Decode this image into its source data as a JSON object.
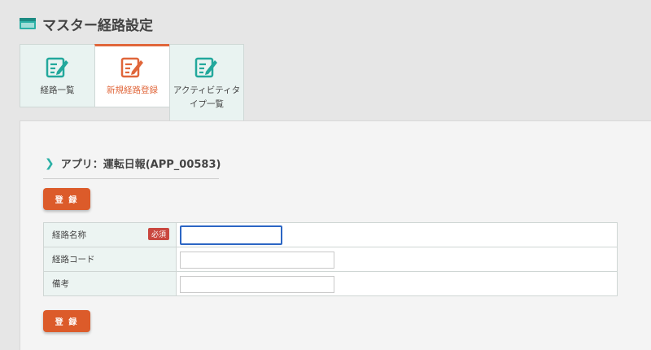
{
  "header": {
    "title": "マスター経路設定",
    "icon": "window-icon"
  },
  "tabs": [
    {
      "label": "経路一覧",
      "icon": "edit-list-icon",
      "active": false
    },
    {
      "label": "新規経路登録",
      "icon": "edit-list-icon",
      "active": true
    },
    {
      "label_lines": [
        "アクティビティタ",
        "イプ一覧"
      ],
      "icon": "edit-list-icon",
      "active": false
    }
  ],
  "app": {
    "title": "アプリ：運転日報(APP_00583)"
  },
  "buttons": {
    "register_label": "登 録"
  },
  "form": {
    "rows": [
      {
        "label": "経路名称",
        "required_label": "必須",
        "value": ""
      },
      {
        "label": "経路コード",
        "value": ""
      },
      {
        "label": "備考",
        "value": ""
      }
    ]
  },
  "colors": {
    "accent": "#dc5b2a",
    "teal": "#2bb0a6",
    "required": "#c9473f",
    "focus": "#2c66c4"
  }
}
